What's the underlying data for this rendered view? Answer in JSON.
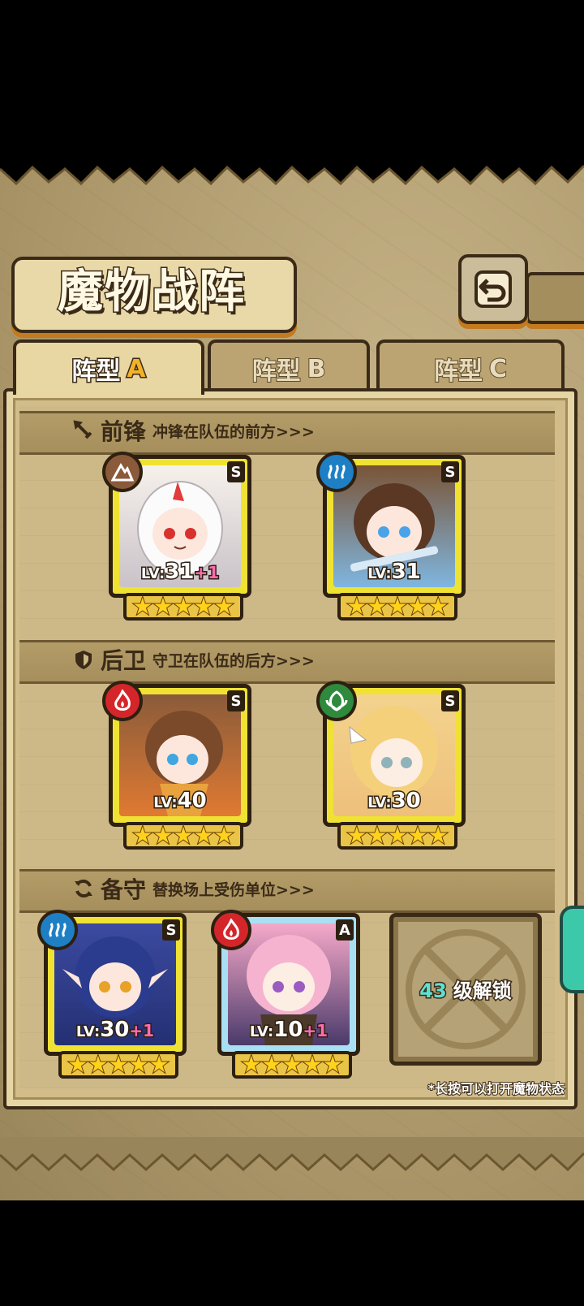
{
  "title": "魔物战阵",
  "tabs": [
    {
      "label": "阵型",
      "letter": "A",
      "active": true
    },
    {
      "label": "阵型",
      "letter": "B",
      "active": false
    },
    {
      "label": "阵型",
      "letter": "C",
      "active": false
    }
  ],
  "sections": {
    "front": {
      "title": "前锋",
      "desc": "冲锋在队伍的前方>>>",
      "icon": "sword-icon"
    },
    "rear": {
      "title": "后卫",
      "desc": "守卫在队伍的后方>>>",
      "icon": "shield-icon"
    },
    "reserve": {
      "title": "备守",
      "desc": "替换场上受伤单位>>>",
      "icon": "swap-icon"
    }
  },
  "units": [
    {
      "level": "31",
      "bonus": "+1",
      "rank": "S",
      "stars": 5,
      "element": "earth-icon"
    },
    {
      "level": "31",
      "bonus": "",
      "rank": "S",
      "stars": 5,
      "element": "water-icon"
    },
    {
      "level": "40",
      "bonus": "",
      "rank": "S",
      "stars": 5,
      "element": "fire-icon"
    },
    {
      "level": "30",
      "bonus": "",
      "rank": "S",
      "stars": 5,
      "element": "wind-icon"
    },
    {
      "level": "30",
      "bonus": "+1",
      "rank": "S",
      "stars": 5,
      "element": "water-icon"
    },
    {
      "level": "10",
      "bonus": "+1",
      "rank": "A",
      "stars": 5,
      "element": "fire-icon"
    }
  ],
  "lv_prefix": "LV:",
  "locked_slot": {
    "level": "43",
    "text": "级解锁"
  },
  "hint": "*长按可以打开魔物状态",
  "colors": {
    "gold_frame": "#f0e233",
    "blue_frame": "#a9dff3",
    "ink": "#2d2010",
    "earth": "#8b5a3a",
    "water": "#1f7fc4",
    "fire": "#d4262a",
    "wind": "#2f8a3d"
  }
}
